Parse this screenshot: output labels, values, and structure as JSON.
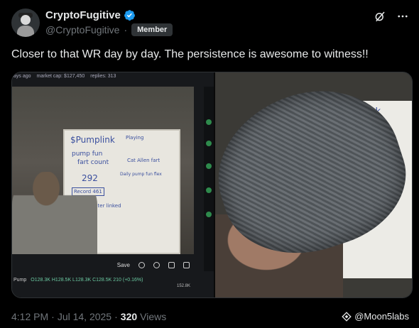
{
  "author": {
    "display_name": "CryptoFugitive",
    "handle": "@CryptoFugitive",
    "separator": "·",
    "badge": "Member"
  },
  "tweet": {
    "text": "Closer to that WR day by day. The persistence is awesome to witness!!"
  },
  "media": {
    "stream_header": [
      "ays ago",
      "market cap: $127,450",
      "replies: 313"
    ],
    "whiteboard": {
      "title": "$Pumplink",
      "line1": "pump fun",
      "line2": "fart count",
      "count": "292",
      "record": "Record 461",
      "note": "Fart counter linked",
      "side1": "Playing",
      "side2": "Cat Allen fart",
      "side3": "Daily pump fun flex"
    },
    "toolbar_label": "Save",
    "pump_label": "Pump",
    "pump_stats": "O128.3K H128.5K L128.3K C128.5K 210 (+0.16%)",
    "price_tick": "152.8K"
  },
  "footer": {
    "time": "4:12 PM",
    "date": "Jul 14, 2025",
    "views_count": "320",
    "views_label": "Views",
    "source": "@Moon5labs"
  },
  "colors": {
    "background": "#000000",
    "verified": "#1d9bf0",
    "muted": "#71767b"
  }
}
